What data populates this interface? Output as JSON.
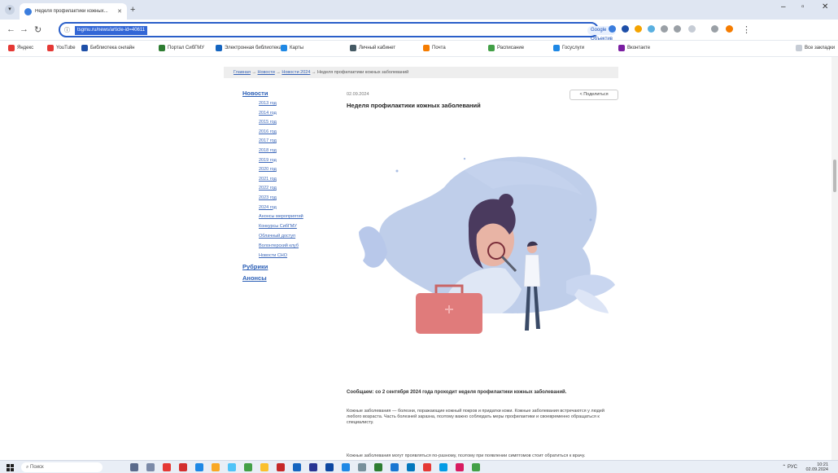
{
  "browser": {
    "tab_title": "Неделя профилактики кожных...",
    "new_tab": "+",
    "url": "tsgmu.ru/news/article-id=40611",
    "search_engine": "Google Объектив",
    "bookmarks": [
      {
        "label": "Яндекс",
        "color": "#e53935"
      },
      {
        "label": "YouTube",
        "color": "#e53935"
      },
      {
        "label": "Библиотека онлайн",
        "color": "#1e4fa8"
      },
      {
        "label": "Портал СибГМУ",
        "color": "#2e7d32"
      },
      {
        "label": "Электронная библиотека",
        "color": "#1565c0"
      },
      {
        "label": "Карты",
        "color": "#1e88e5"
      },
      {
        "label": "Личный кабинет",
        "color": "#455a64"
      },
      {
        "label": "Почта",
        "color": "#f57c00"
      },
      {
        "label": "Расписание",
        "color": "#43a047"
      },
      {
        "label": "Госуслуги",
        "color": "#1e88e5"
      },
      {
        "label": "Вконтакте",
        "color": "#7b1fa2"
      }
    ],
    "all_bookmarks": "Все закладки"
  },
  "breadcrumb": {
    "items": [
      "Главная",
      "Новости",
      "Новости 2024"
    ],
    "current": "Неделя профилактики кожных заболеваний"
  },
  "sidebar": {
    "news_heading": "Новости",
    "years": [
      "2013 год",
      "2014 год",
      "2015 год",
      "2016 год",
      "2017 год",
      "2018 год",
      "2019 год",
      "2020 год",
      "2021 год",
      "2022 год",
      "2023 год",
      "2024 год"
    ],
    "subs": [
      "Анонсы мероприятий",
      "Конкурсы СибГМУ",
      "Облачный доступ",
      "Волонтерский клуб",
      "Новости СНО"
    ],
    "rubrics": "Рубрики",
    "announcements": "Анонсы"
  },
  "article": {
    "date": "02.09.2024",
    "title": "Неделя профилактики кожных заболеваний",
    "share": "Поделиться",
    "lead": "Сообщаем: со 2 сентября 2024 года проходит неделя профилактики кожных заболеваний.",
    "paragraph": "Кожные заболевания — болезни, поражающие кожный покров и придатки кожи. Кожные заболевания встречаются у людей любого возраста. Часть болезней заразна, поэтому важно соблюдать меры профилактики и своевременно обращаться к специалисту.",
    "paragraph2": "Кожные заболевания могут проявляться по-разному, поэтому при появлении симптомов стоит обратиться к врачу."
  },
  "taskbar": {
    "search_placeholder": "Поиск",
    "time": "10:21",
    "date": "02.09.2024",
    "lang": "РУС"
  },
  "colors": {
    "accent": "#2a5fc9",
    "link": "#3a66b8",
    "blob": "#a9bde3",
    "skin": "#e8b4a5",
    "hair": "#4a3a5e",
    "suitcase": "#e07b7b"
  }
}
